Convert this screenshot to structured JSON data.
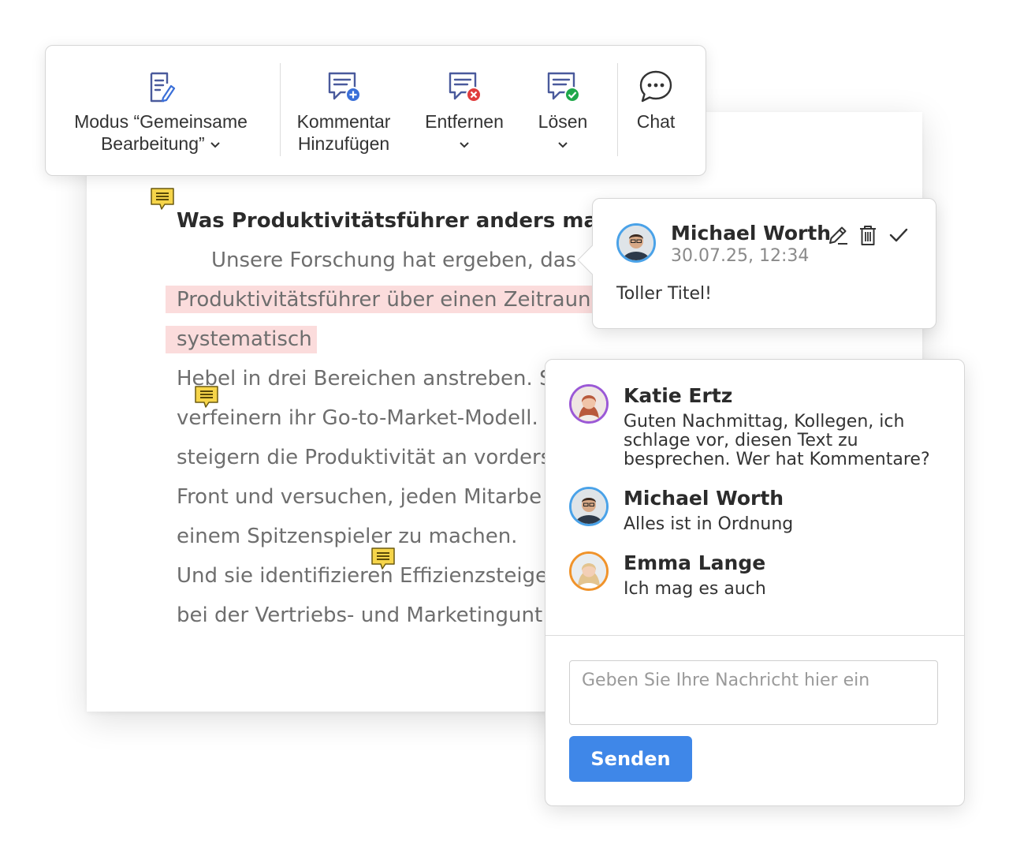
{
  "toolbar": {
    "coedit": {
      "line1": "Modus “Gemeinsame",
      "line2": "Bearbeitung”"
    },
    "add_comment": {
      "line1": "Kommentar",
      "line2": "Hinzufügen"
    },
    "remove": {
      "label": "Entfernen"
    },
    "resolve": {
      "label": "Lösen"
    },
    "chat": {
      "label": "Chat"
    },
    "icons": {
      "coedit": "edit-document-icon",
      "add": "comment-add-icon",
      "remove": "comment-remove-icon",
      "resolve": "comment-resolve-icon",
      "chat": "chat-bubble-icon"
    }
  },
  "document": {
    "title": "Was Produktivitätsführer anders mac",
    "lines": [
      "Unsere Forschung hat ergeben, das",
      "Produktivitätsführer über einen Zeitraun",
      "systematisch",
      "Hebel in drei Bereichen anstreben. S",
      "verfeinern ihr Go-to-Market-Modell.",
      "steigern die Produktivität an vorders",
      "Front und versuchen, jeden Mitarbe",
      "einem Spitzenspieler zu machen.",
      "Und sie identifizieren Effizienzsteige",
      "bei der Vertriebs- und Marketingunt"
    ]
  },
  "comment": {
    "author": "Michael Worth",
    "timestamp": "30.07.25, 12:34",
    "text": "Toller Titel!",
    "icons": {
      "edit": "pencil-icon",
      "delete": "trash-icon",
      "resolve": "check-icon"
    }
  },
  "chat": {
    "messages": [
      {
        "author": "Katie Ertz",
        "lines": [
          "Guten Nachmittag, Kollegen, ich",
          "schlage vor, diesen Text zu",
          "besprechen. Wer hat Kommentare?"
        ],
        "ring": "#9b59d6"
      },
      {
        "author": "Michael Worth",
        "lines": [
          "Alles ist in Ordnung"
        ],
        "ring": "#4aa2e8"
      },
      {
        "author": "Emma Lange",
        "lines": [
          "Ich mag es auch"
        ],
        "ring": "#f0932b"
      }
    ],
    "input_placeholder": "Geben Sie Ihre Nachricht hier ein",
    "send_label": "Senden"
  },
  "colors": {
    "accent": "#3f87e8",
    "highlight": "#fbdcdc",
    "note": "#f6d54a",
    "remove_badge": "#e03c3c",
    "resolve_badge": "#1ea84a",
    "add_badge": "#3a6fd8"
  }
}
